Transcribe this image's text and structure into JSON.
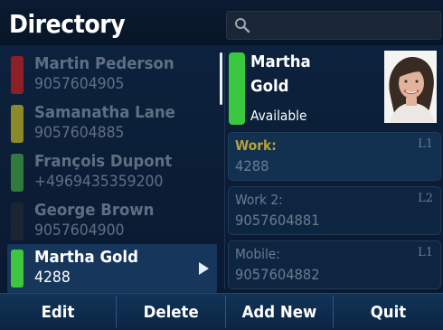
{
  "header": {
    "title": "Directory",
    "search_icon": "search-icon"
  },
  "contacts": [
    {
      "name": "Martin Pederson",
      "number": "9057604905",
      "status_color": "#8e1f26"
    },
    {
      "name": "Samanatha Lane",
      "number": "9057604885",
      "status_color": "#8b8a2a"
    },
    {
      "name": "François Dupont",
      "number": "+4969435359200",
      "status_color": "#2f7a3c"
    },
    {
      "name": "George Brown",
      "number": "9057604900",
      "status_color": "#1a2433"
    },
    {
      "name": "Martha Gold",
      "number": "4288",
      "status_color": "#3fc63f",
      "selected": true
    }
  ],
  "detail": {
    "first_name": "Martha",
    "last_name": "Gold",
    "presence": "Available",
    "status_color": "#39c83f",
    "fields": [
      {
        "label": "Work:",
        "value": "4288",
        "line": "L1",
        "active": true
      },
      {
        "label": "Work 2:",
        "value": "9057604881",
        "line": "L2",
        "active": false
      },
      {
        "label": "Mobile:",
        "value": "9057604882",
        "line": "L1",
        "active": false
      }
    ]
  },
  "softkeys": [
    "Edit",
    "Delete",
    "Add New",
    "Quit"
  ]
}
